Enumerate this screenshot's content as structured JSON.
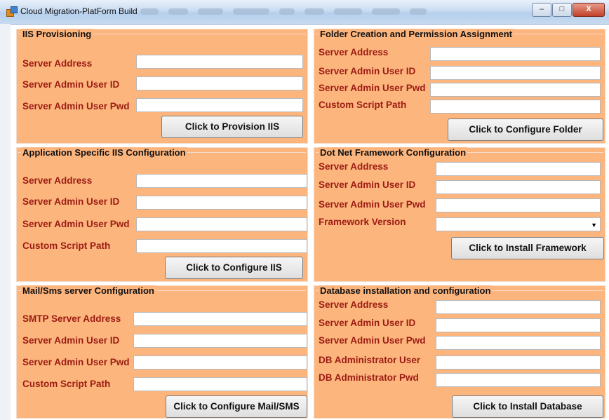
{
  "window": {
    "title": "Cloud Migration-PlatForm Build"
  },
  "panels": {
    "iis": {
      "title": "IIS Provisioning",
      "server_address": "Server Address",
      "admin_user_id": "Server Admin User ID",
      "admin_user_pwd": "Server Admin User Pwd",
      "button": "Click to Provision IIS"
    },
    "folder": {
      "title": "Folder Creation and Permission Assignment",
      "server_address": "Server Address",
      "admin_user_id": "Server Admin User ID",
      "admin_user_pwd": "Server Admin User Pwd",
      "custom_script_path": "Custom Script Path",
      "button": "Click to Configure Folder"
    },
    "app_iis": {
      "title": "Application Specific IIS Configuration",
      "server_address": "Server Address",
      "admin_user_id": "Server Admin User ID",
      "admin_user_pwd": "Server Admin User Pwd",
      "custom_script_path": "Custom Script Path",
      "button": "Click to Configure IIS"
    },
    "dotnet": {
      "title": "Dot Net Framework Configuration",
      "server_address": "Server Address",
      "admin_user_id": "Server Admin User ID",
      "admin_user_pwd": "Server Admin User Pwd",
      "framework_version": "Framework Version",
      "button": "Click to Install Framework"
    },
    "mail": {
      "title": "Mail/Sms  server Configuration",
      "smtp_address": "SMTP Server Address",
      "admin_user_id": "Server Admin User ID",
      "admin_user_pwd": "Server Admin User Pwd",
      "custom_script_path": "Custom Script Path",
      "button": "Click to Configure Mail/SMS"
    },
    "database": {
      "title": "Database installation and configuration",
      "server_address": "Server Address",
      "admin_user_id": "Server Admin User ID",
      "admin_user_pwd": "Server Admin User Pwd",
      "db_admin_user": "DB Administrator User",
      "db_admin_pwd": "DB Administrator Pwd",
      "button": "Click to Install Database"
    }
  },
  "colors": {
    "panel": "#fdb57e",
    "label": "#9b1c12"
  }
}
